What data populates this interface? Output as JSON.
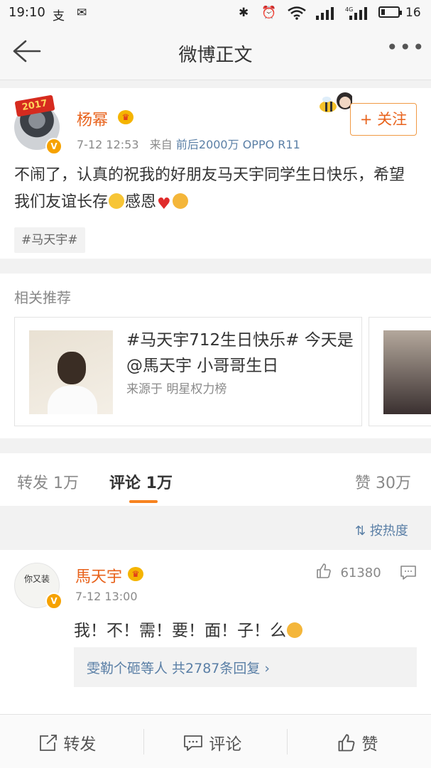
{
  "status_bar": {
    "time": "19:10",
    "battery": "16"
  },
  "nav": {
    "title": "微博正文"
  },
  "post": {
    "badge": "2017",
    "username": "杨幂",
    "time": "7-12 12:53",
    "source_prefix": "来自",
    "source": "前后2000万 OPPO R11",
    "follow_label": "+ 关注",
    "text_part1": "不闹了，认真的祝我的好朋友马天宇同学生日快乐，希望我们友谊长存",
    "text_part2": "感恩",
    "tag": "#马天宇#"
  },
  "related": {
    "heading": "相关推荐",
    "card_title": "#马天宇712生日快乐# 今天是@馬天宇 小哥哥生日",
    "card_source": "来源于 明星权力榜"
  },
  "tabs": {
    "repost": "转发 1万",
    "comment": "评论 1万",
    "like": "赞 30万"
  },
  "sort_label": "按热度",
  "comment": {
    "avatar_text": "你又装",
    "username": "馬天宇",
    "time": "7-12 13:00",
    "likes": "61380",
    "text": "我！不！需！要！面！子！么",
    "replies": "雯勒个砸等人  共2787条回复 ›"
  },
  "bottom_bar": {
    "repost": "转发",
    "comment": "评论",
    "like": "赞"
  }
}
